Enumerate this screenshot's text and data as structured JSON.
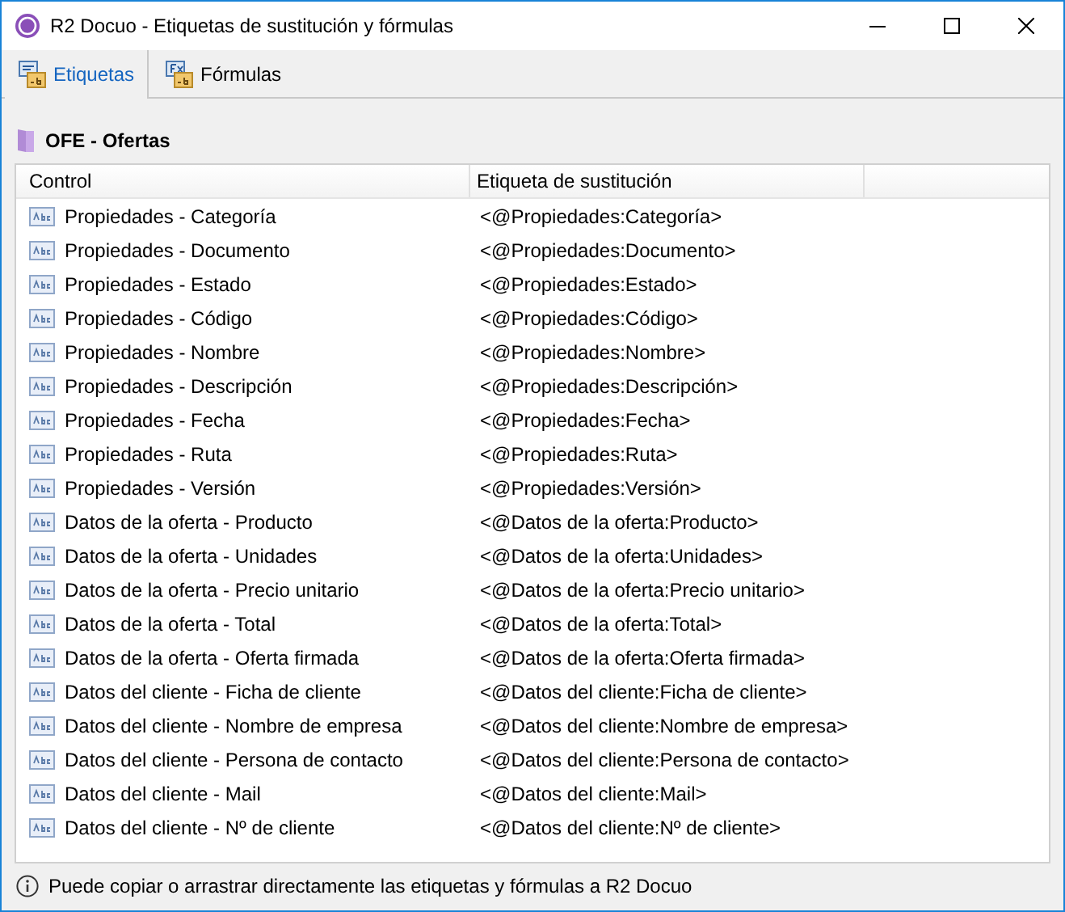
{
  "window": {
    "title": "R2 Docuo - Etiquetas de sustitución y fórmulas"
  },
  "tabs": [
    {
      "label": "Etiquetas",
      "selected": true,
      "kind": "tags"
    },
    {
      "label": "Fórmulas",
      "selected": false,
      "kind": "formulas"
    }
  ],
  "section": {
    "title": "OFE - Ofertas"
  },
  "table": {
    "columns": [
      "Control",
      "Etiqueta de sustitución"
    ],
    "rows": [
      [
        "Propiedades - Categoría",
        "<@Propiedades:Categoría>"
      ],
      [
        "Propiedades - Documento",
        "<@Propiedades:Documento>"
      ],
      [
        "Propiedades - Estado",
        "<@Propiedades:Estado>"
      ],
      [
        "Propiedades - Código",
        "<@Propiedades:Código>"
      ],
      [
        "Propiedades - Nombre",
        "<@Propiedades:Nombre>"
      ],
      [
        "Propiedades - Descripción",
        "<@Propiedades:Descripción>"
      ],
      [
        "Propiedades - Fecha",
        "<@Propiedades:Fecha>"
      ],
      [
        "Propiedades - Ruta",
        "<@Propiedades:Ruta>"
      ],
      [
        "Propiedades - Versión",
        "<@Propiedades:Versión>"
      ],
      [
        "Datos de la oferta - Producto",
        "<@Datos de la oferta:Producto>"
      ],
      [
        "Datos de la oferta - Unidades",
        "<@Datos de la oferta:Unidades>"
      ],
      [
        "Datos de la oferta - Precio unitario",
        "<@Datos de la oferta:Precio unitario>"
      ],
      [
        "Datos de la oferta - Total",
        "<@Datos de la oferta:Total>"
      ],
      [
        "Datos de la oferta - Oferta firmada",
        "<@Datos de la oferta:Oferta firmada>"
      ],
      [
        "Datos del cliente - Ficha de cliente",
        "<@Datos del cliente:Ficha de cliente>"
      ],
      [
        "Datos del cliente - Nombre de empresa",
        "<@Datos del cliente:Nombre de empresa>"
      ],
      [
        "Datos del cliente - Persona de contacto",
        "<@Datos del cliente:Persona de contacto>"
      ],
      [
        "Datos del cliente - Mail",
        "<@Datos del cliente:Mail>"
      ],
      [
        "Datos del cliente - Nº de cliente",
        "<@Datos del cliente:Nº de cliente>"
      ]
    ]
  },
  "status_bar": {
    "text": "Puede copiar o arrastrar directamente las etiquetas y fórmulas a R2 Docuo"
  }
}
